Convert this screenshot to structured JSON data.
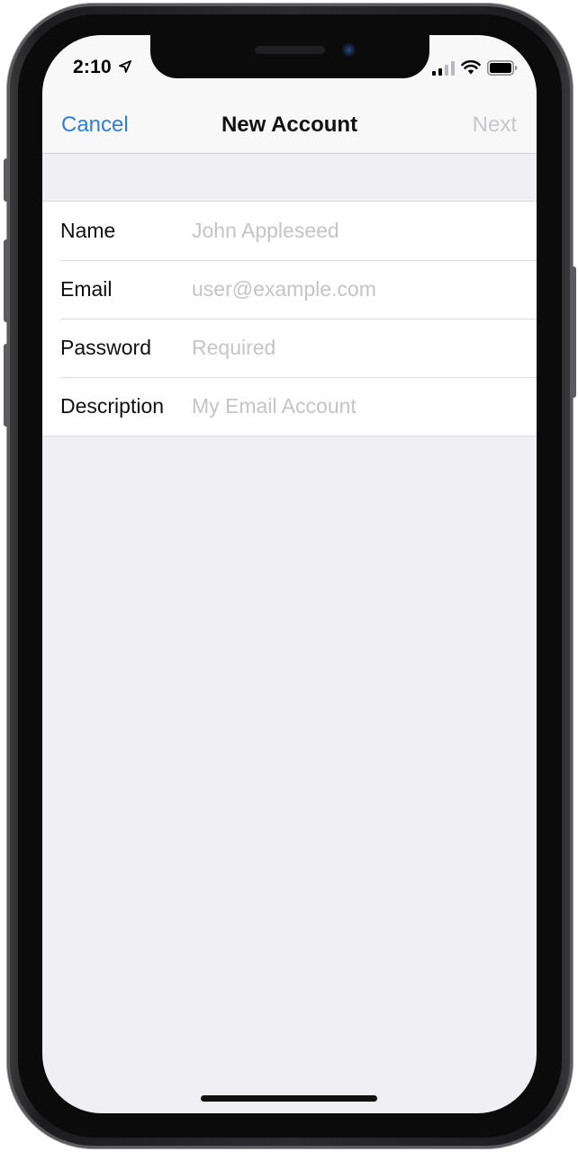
{
  "status_bar": {
    "time": "2:10",
    "icons": [
      "location-arrow-icon",
      "cellular-signal-icon",
      "wifi-icon",
      "battery-icon"
    ]
  },
  "nav": {
    "cancel_label": "Cancel",
    "title": "New Account",
    "next_label": "Next"
  },
  "form": {
    "rows": [
      {
        "label": "Name",
        "placeholder": "John Appleseed"
      },
      {
        "label": "Email",
        "placeholder": "user@example.com"
      },
      {
        "label": "Password",
        "placeholder": "Required"
      },
      {
        "label": "Description",
        "placeholder": "My Email Account"
      }
    ]
  },
  "colors": {
    "accent": "#2f7fd6",
    "disabled": "#c7c7cc",
    "background": "#efeff4",
    "placeholder": "#c4c4c9"
  }
}
